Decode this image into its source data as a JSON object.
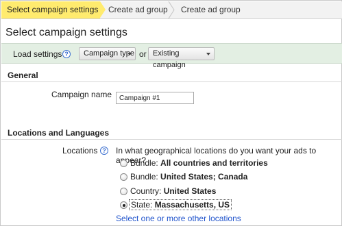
{
  "steps": [
    {
      "label": "Select campaign settings",
      "active": true
    },
    {
      "label": "Create ad group",
      "active": false
    },
    {
      "label": "Create ad group",
      "active": false
    }
  ],
  "page_title": "Select campaign settings",
  "load_settings": {
    "label": "Load settings",
    "help_icon": "question-circle-icon",
    "campaign_type_label": "Campaign type",
    "or_text": "or",
    "existing_campaign_label": "Existing campaign"
  },
  "general": {
    "header": "General",
    "campaign_name_label": "Campaign name",
    "campaign_name_value": "Campaign #1"
  },
  "locations": {
    "header": "Locations and Languages",
    "label": "Locations",
    "help_icon": "question-circle-icon",
    "question": "In what geographical locations do you want your ads to appear?",
    "options": [
      {
        "prefix": "Bundle: ",
        "bold": "All countries and territories",
        "checked": false
      },
      {
        "prefix": "Bundle: ",
        "bold": "United States; Canada",
        "checked": false
      },
      {
        "prefix": "Country: ",
        "bold": "United States",
        "checked": false
      },
      {
        "prefix": "State: ",
        "bold": "Massachusetts, US",
        "checked": true
      }
    ],
    "other_link": "Select one or more other locations"
  },
  "colors": {
    "active_step": "#ffeb6e",
    "load_bar": "#e3efe3",
    "link": "#2255cc"
  }
}
